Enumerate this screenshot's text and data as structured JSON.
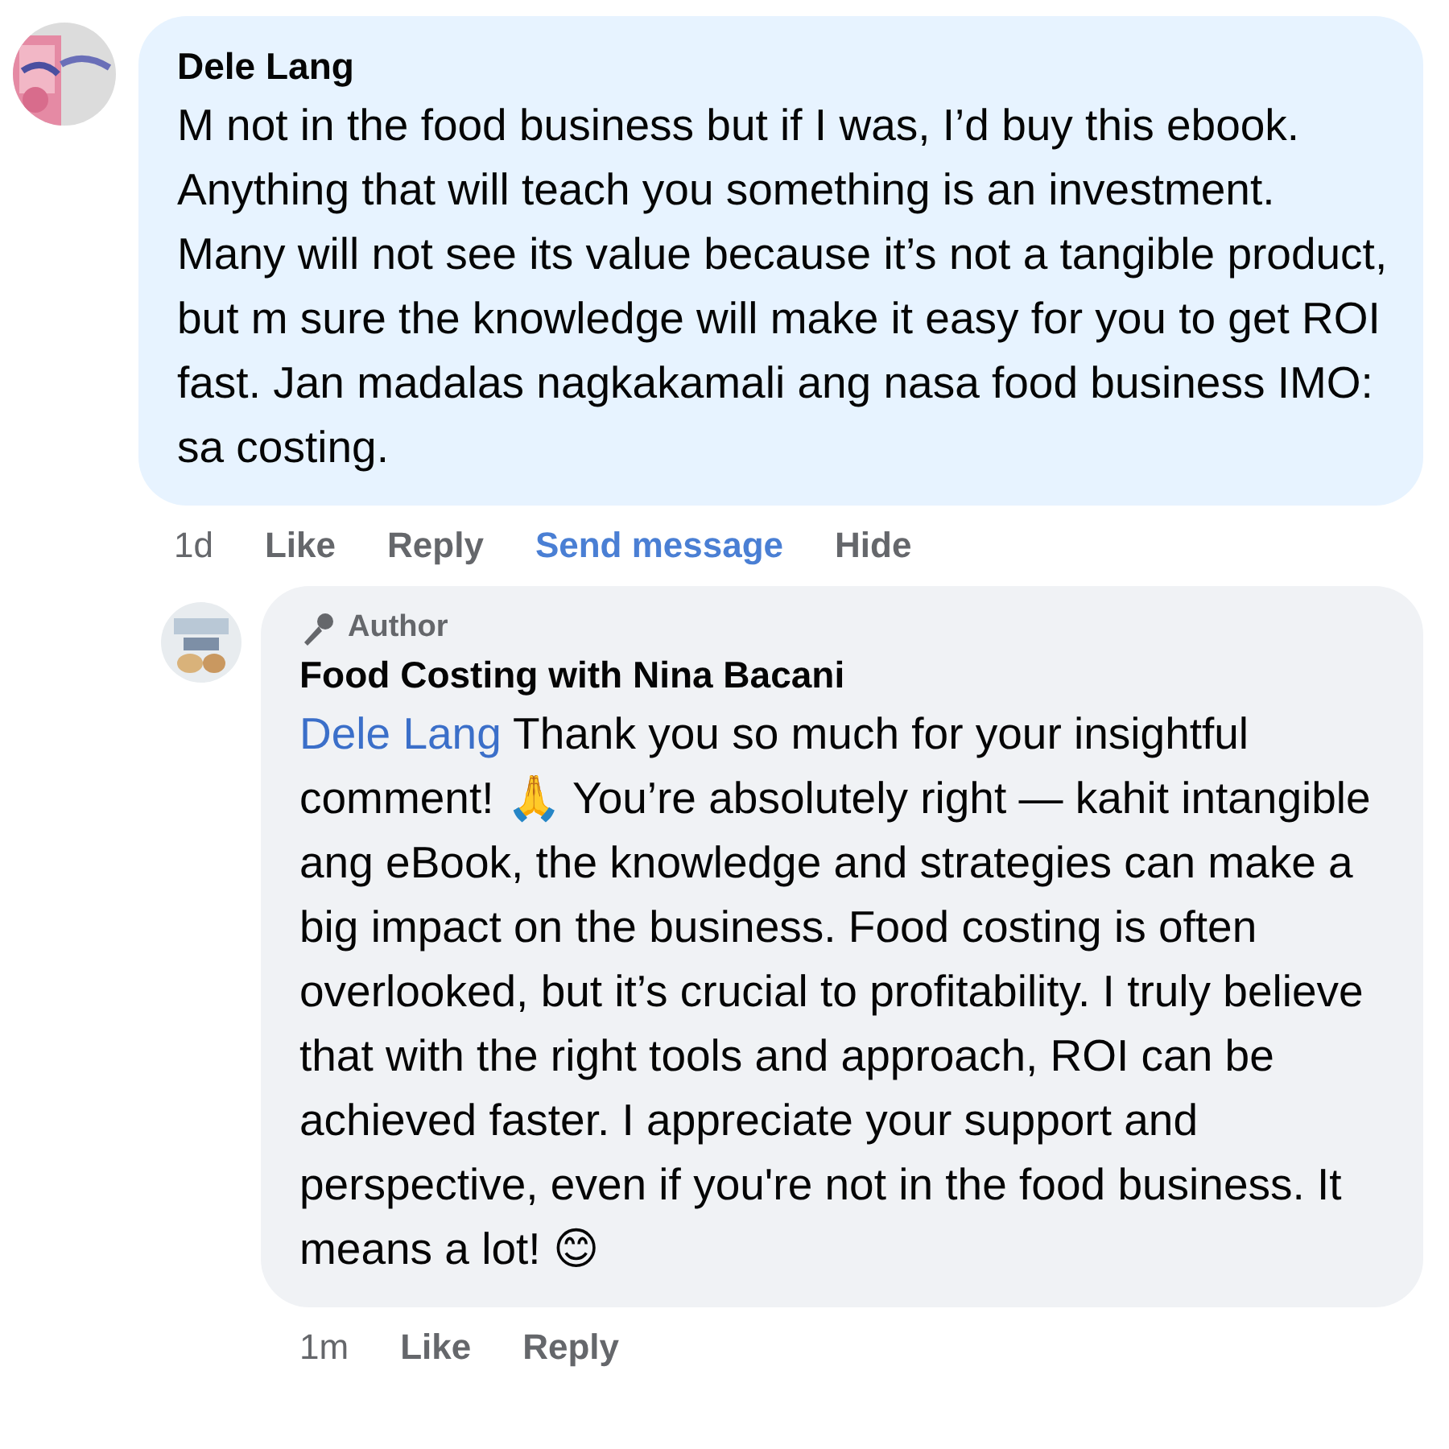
{
  "comment": {
    "author": "Dele Lang",
    "text": "M not in the food business but if I was, I’d buy this ebook. Anything that will teach you something is an investment. Many will not see its value because it’s not a tangible product, but m sure the knowledge will make it easy for you to get ROI fast. Jan madalas nagkakamali ang nasa food business IMO: sa costing.",
    "actions": [
      {
        "kind": "time",
        "label": "1d"
      },
      {
        "kind": "action",
        "label": "Like"
      },
      {
        "kind": "action",
        "label": "Reply"
      },
      {
        "kind": "link",
        "label": "Send message"
      },
      {
        "kind": "action",
        "label": "Hide"
      }
    ]
  },
  "reply": {
    "badge": "Author",
    "author": "Food Costing with Nina Bacani",
    "mention": "Dele Lang",
    "text": " Thank you so much for your insightful comment! 🙏 You’re absolutely right — kahit intangible ang eBook, the knowledge and strategies can make a big impact on the business. Food costing is often overlooked, but it’s crucial to profitability. I truly believe that with the right tools and approach, ROI can be achieved faster. I appreciate your support and perspective, even if you're not in the food business. It means a lot! 😊",
    "actions": [
      {
        "kind": "time",
        "label": "1m"
      },
      {
        "kind": "action",
        "label": "Like"
      },
      {
        "kind": "action",
        "label": "Reply"
      }
    ]
  }
}
